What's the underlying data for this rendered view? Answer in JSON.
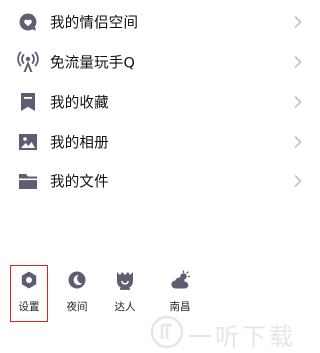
{
  "menu": {
    "items": [
      {
        "label": "我的情侣空间",
        "icon": "heart-chat-icon"
      },
      {
        "label": "免流量玩手Q",
        "icon": "signal-tower-icon"
      },
      {
        "label": "我的收藏",
        "icon": "bookmark-icon"
      },
      {
        "label": "我的相册",
        "icon": "photo-icon"
      },
      {
        "label": "我的文件",
        "icon": "folder-icon"
      }
    ]
  },
  "bottom_bar": {
    "items": [
      {
        "label": "设置",
        "icon": "settings-hexagon-icon",
        "highlighted": true
      },
      {
        "label": "夜间",
        "icon": "moon-icon"
      },
      {
        "label": "达人",
        "icon": "talent-badge-icon"
      },
      {
        "label": "南昌",
        "icon": "weather-cloud-sun-icon"
      }
    ]
  },
  "watermark": {
    "text": "一听下载"
  },
  "colors": {
    "icon": "#5d5e72",
    "chevron": "#c2c2c8",
    "highlight": "#e0261d",
    "text": "#111111"
  }
}
